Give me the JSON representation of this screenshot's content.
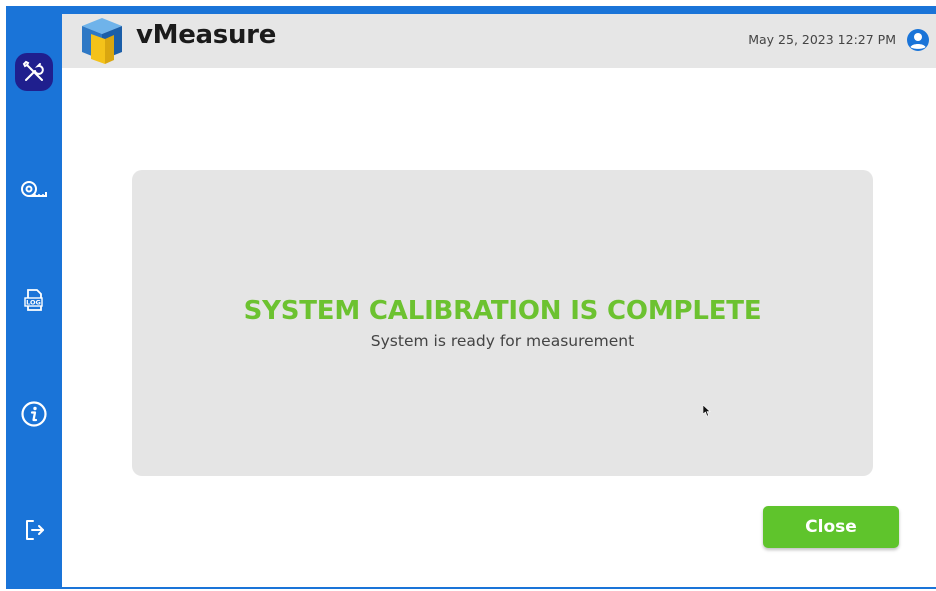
{
  "app": {
    "title": "vMeasure"
  },
  "header": {
    "datetime": "May 25, 2023 12:27 PM"
  },
  "sidebar": {
    "items": [
      {
        "name": "calibration",
        "icon": "tools-icon",
        "active": true
      },
      {
        "name": "measure",
        "icon": "tape-measure-icon",
        "active": false
      },
      {
        "name": "log",
        "icon": "log-icon",
        "label": "LOG",
        "active": false
      },
      {
        "name": "info",
        "icon": "info-icon",
        "active": false
      },
      {
        "name": "logout",
        "icon": "logout-icon",
        "active": false
      }
    ]
  },
  "panel": {
    "title": "SYSTEM CALIBRATION IS COMPLETE",
    "subtitle": "System is ready for measurement"
  },
  "actions": {
    "close_label": "Close"
  },
  "colors": {
    "sidebar": "#1a74d8",
    "active_item": "#1f1f8e",
    "success": "#6cc230",
    "button": "#5fc42c",
    "header": "#e6e6e6",
    "panel": "#e5e5e5"
  }
}
